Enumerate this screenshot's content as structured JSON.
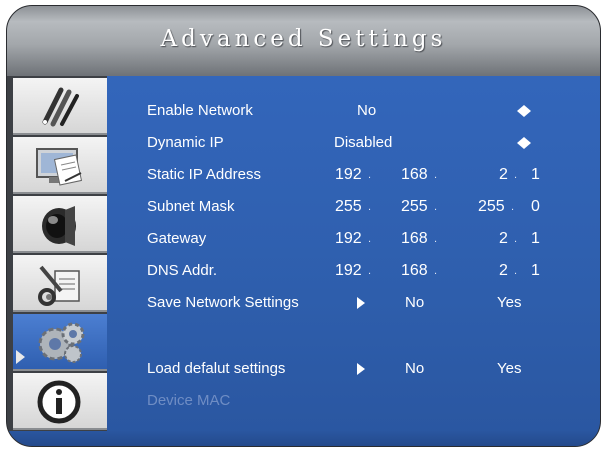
{
  "window": {
    "title": "Advanced Settings"
  },
  "sidebar": {
    "items": [
      {
        "icon": "pens-icon"
      },
      {
        "icon": "monitor-icon"
      },
      {
        "icon": "speaker-icon"
      },
      {
        "icon": "tools-icon"
      },
      {
        "icon": "gears-icon",
        "selected": true
      },
      {
        "icon": "info-icon"
      }
    ]
  },
  "settings": {
    "enable_network": {
      "label": "Enable Network",
      "value": "No"
    },
    "dynamic_ip": {
      "label": "Dynamic IP",
      "value": "Disabled"
    },
    "static_ip": {
      "label": "Static IP Address",
      "octets": [
        "192",
        "168",
        "2",
        "1"
      ]
    },
    "subnet_mask": {
      "label": "Subnet Mask",
      "octets": [
        "255",
        "255",
        "255",
        "0"
      ]
    },
    "gateway": {
      "label": "Gateway",
      "octets": [
        "192",
        "168",
        "2",
        "1"
      ]
    },
    "dns": {
      "label": "DNS Addr.",
      "octets": [
        "192",
        "168",
        "2",
        "1"
      ]
    },
    "save_network": {
      "label": "Save Network Settings",
      "no": "No",
      "yes": "Yes"
    },
    "load_default": {
      "label": "Load defalut settings",
      "no": "No",
      "yes": "Yes"
    },
    "device_mac": {
      "label": "Device MAC"
    }
  },
  "separator": "."
}
